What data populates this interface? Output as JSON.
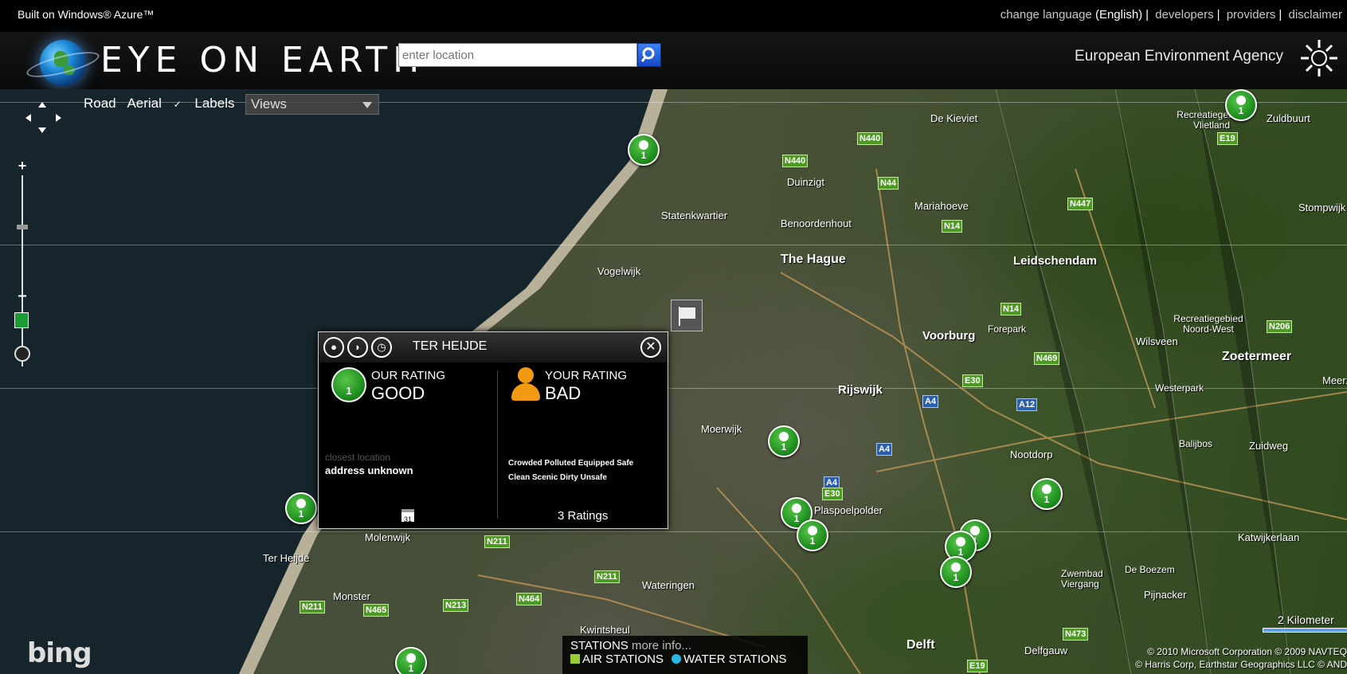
{
  "topbar": {
    "built_on": "Built on Windows® Azure™",
    "change_language": "change language",
    "language": "(English)",
    "links": [
      "developers",
      "providers",
      "disclaimer"
    ]
  },
  "header": {
    "logo_text": "EYE ON EARTH",
    "search_placeholder": "enter location",
    "agency": "European Environment Agency"
  },
  "map_controls": {
    "tabs": [
      "Road",
      "Aerial"
    ],
    "labels_toggle": "Labels",
    "labels_checked": true,
    "views_select": "Views"
  },
  "map": {
    "places": [
      {
        "name": "De Kieviet",
        "cls": ""
      },
      {
        "name": "Duinzigt",
        "cls": ""
      },
      {
        "name": "Mariahoeve",
        "cls": ""
      },
      {
        "name": "Statenkwartier",
        "cls": ""
      },
      {
        "name": "Benoordenhout",
        "cls": ""
      },
      {
        "name": "The Hague",
        "cls": "big"
      },
      {
        "name": "Leidschendam",
        "cls": "big"
      },
      {
        "name": "Vogelwijk",
        "cls": ""
      },
      {
        "name": "Voorburg",
        "cls": "big"
      },
      {
        "name": "Forepark",
        "cls": "small"
      },
      {
        "name": "Wilsveen",
        "cls": ""
      },
      {
        "name": "Zoetermeer",
        "cls": "big"
      },
      {
        "name": "Rijswijk",
        "cls": "big"
      },
      {
        "name": "Moerwijk",
        "cls": ""
      },
      {
        "name": "Nootdorp",
        "cls": ""
      },
      {
        "name": "Plaspoelpolder",
        "cls": ""
      },
      {
        "name": "Westerpark",
        "cls": "small"
      },
      {
        "name": "Balijbos",
        "cls": "small"
      },
      {
        "name": "Zuidweg",
        "cls": ""
      },
      {
        "name": "Stompwijk",
        "cls": ""
      },
      {
        "name": "Zuldbuurt",
        "cls": ""
      },
      {
        "name": "Recreatiegebied Vlietland",
        "cls": "small"
      },
      {
        "name": "Recreatiegebied Noord-West",
        "cls": "small"
      },
      {
        "name": "Katwijkerlaan",
        "cls": ""
      },
      {
        "name": "Molenwijk",
        "cls": ""
      },
      {
        "name": "Ter Heijde",
        "cls": ""
      },
      {
        "name": "Monster",
        "cls": ""
      },
      {
        "name": "Wateringen",
        "cls": ""
      },
      {
        "name": "Kwintsheul",
        "cls": ""
      },
      {
        "name": "Delft",
        "cls": "big"
      },
      {
        "name": "Delfgauw",
        "cls": ""
      },
      {
        "name": "Pijnacker",
        "cls": ""
      },
      {
        "name": "De Boezem",
        "cls": "small"
      },
      {
        "name": "Zwembad Viergang",
        "cls": "small"
      },
      {
        "name": "Meerzi",
        "cls": ""
      }
    ],
    "roads": [
      "N440",
      "N440",
      "N44",
      "N14",
      "N447",
      "N14",
      "N469",
      "E30",
      "A4",
      "A12",
      "A4",
      "A4",
      "E30",
      "N206",
      "E19",
      "N211",
      "N211",
      "N213",
      "N464",
      "N465",
      "N211",
      "N473",
      "E19",
      "A4"
    ],
    "pin_label": "1"
  },
  "popup": {
    "title": "TER HEIJDE",
    "our_rating_label": "OUR RATING",
    "our_rating_value": "GOOD",
    "your_rating_label": "YOUR RATING",
    "your_rating_value": "BAD",
    "closest_label": "closest location",
    "closest_value": "address unknown",
    "tags_line1": "Crowded Polluted Equipped Safe",
    "tags_line2": "Clean Scenic Dirty Unsafe",
    "calendar_day": "31",
    "ratings_count": "3 Ratings",
    "close_symbol": "✕"
  },
  "footer": {
    "bing": "bing",
    "stations_title": "STATIONS",
    "stations_more": "more info...",
    "air_stations": "AIR STATIONS",
    "water_stations": "WATER STATIONS",
    "air_color": "#9acd32",
    "water_color": "#27b8e8",
    "scale": "2 Kilometer",
    "copyright1": "© 2010 Microsoft Corporation  © 2009 NAVTEQ",
    "copyright2": "© Harris Corp, Earthstar Geographics LLC  © AND"
  }
}
